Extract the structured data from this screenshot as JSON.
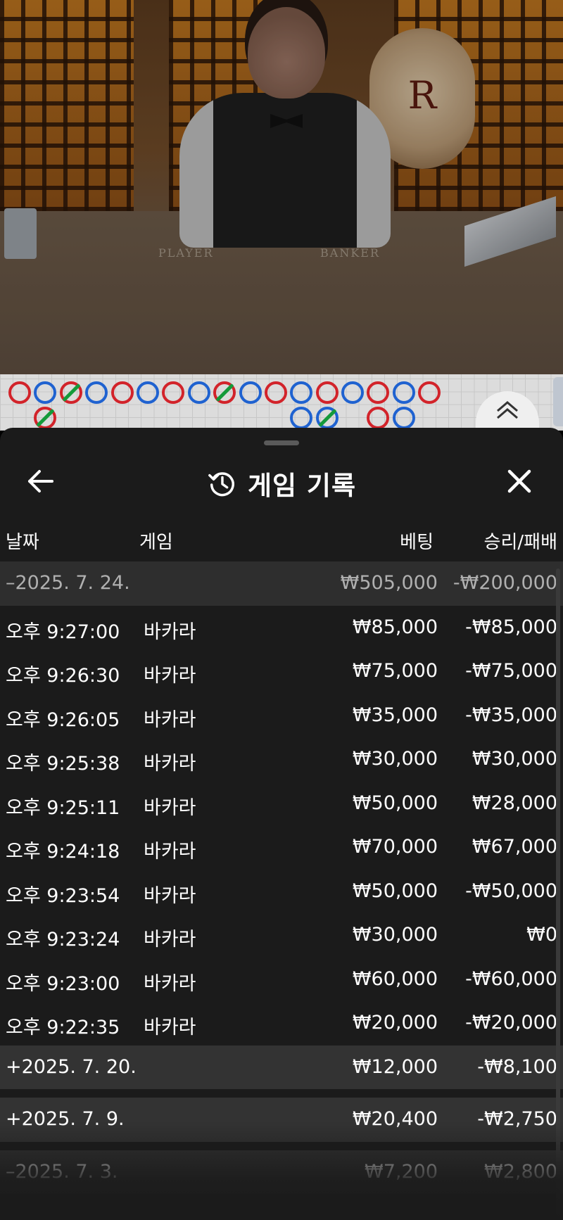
{
  "live_video": {
    "felt_labels": {
      "player": "PLAYER",
      "banker": "BANKER"
    },
    "plaque_letter": "R"
  },
  "bead_road": {
    "row1": [
      "B",
      "P",
      "BT",
      "P",
      "B",
      "P",
      "B",
      "P",
      "BT",
      "P",
      "B",
      "P",
      "B",
      "P",
      "B",
      "P",
      "B"
    ],
    "row2": [
      "E",
      "BT",
      "E",
      "E",
      "E",
      "E",
      "E",
      "E",
      "E",
      "E",
      "E",
      "P",
      "PT",
      "E",
      "B",
      "P",
      "E"
    ]
  },
  "colors": {
    "banker_red": "#d2232a",
    "player_blue": "#1f62d0",
    "tie_green": "#149a3a",
    "sheet_bg": "#1b1b1b"
  },
  "sheet": {
    "title": "게임 기록",
    "title_icon": "history-icon",
    "back_icon": "arrow-left-icon",
    "close_icon": "close-icon",
    "columns": {
      "date": "날짜",
      "game": "게임",
      "bet": "베팅",
      "result": "승리/패배"
    }
  },
  "history": {
    "open_group": {
      "sign": "–",
      "date": "2025. 7. 24.",
      "bet": "₩505,000",
      "result": "-₩200,000"
    },
    "rows": [
      {
        "time": "오후 9:27:00",
        "game": "바카라",
        "bet": "₩85,000",
        "result": "-₩85,000"
      },
      {
        "time": "오후 9:26:30",
        "game": "바카라",
        "bet": "₩75,000",
        "result": "-₩75,000"
      },
      {
        "time": "오후 9:26:05",
        "game": "바카라",
        "bet": "₩35,000",
        "result": "-₩35,000"
      },
      {
        "time": "오후 9:25:38",
        "game": "바카라",
        "bet": "₩30,000",
        "result": "₩30,000"
      },
      {
        "time": "오후 9:25:11",
        "game": "바카라",
        "bet": "₩50,000",
        "result": "₩28,000"
      },
      {
        "time": "오후 9:24:18",
        "game": "바카라",
        "bet": "₩70,000",
        "result": "₩67,000"
      },
      {
        "time": "오후 9:23:54",
        "game": "바카라",
        "bet": "₩50,000",
        "result": "-₩50,000"
      },
      {
        "time": "오후 9:23:24",
        "game": "바카라",
        "bet": "₩30,000",
        "result": "₩0"
      },
      {
        "time": "오후 9:23:00",
        "game": "바카라",
        "bet": "₩60,000",
        "result": "-₩60,000"
      },
      {
        "time": "오후 9:22:35",
        "game": "바카라",
        "bet": "₩20,000",
        "result": "-₩20,000"
      }
    ],
    "collapsed_groups": [
      {
        "sign": "+",
        "date": "2025. 7. 20.",
        "bet": "₩12,000",
        "result": "-₩8,100"
      },
      {
        "sign": "+",
        "date": "2025. 7. 9.",
        "bet": "₩20,400",
        "result": "-₩2,750"
      },
      {
        "sign": "–",
        "date": "2025. 7. 3.",
        "bet": "₩7,200",
        "result": "₩2,800"
      }
    ]
  }
}
